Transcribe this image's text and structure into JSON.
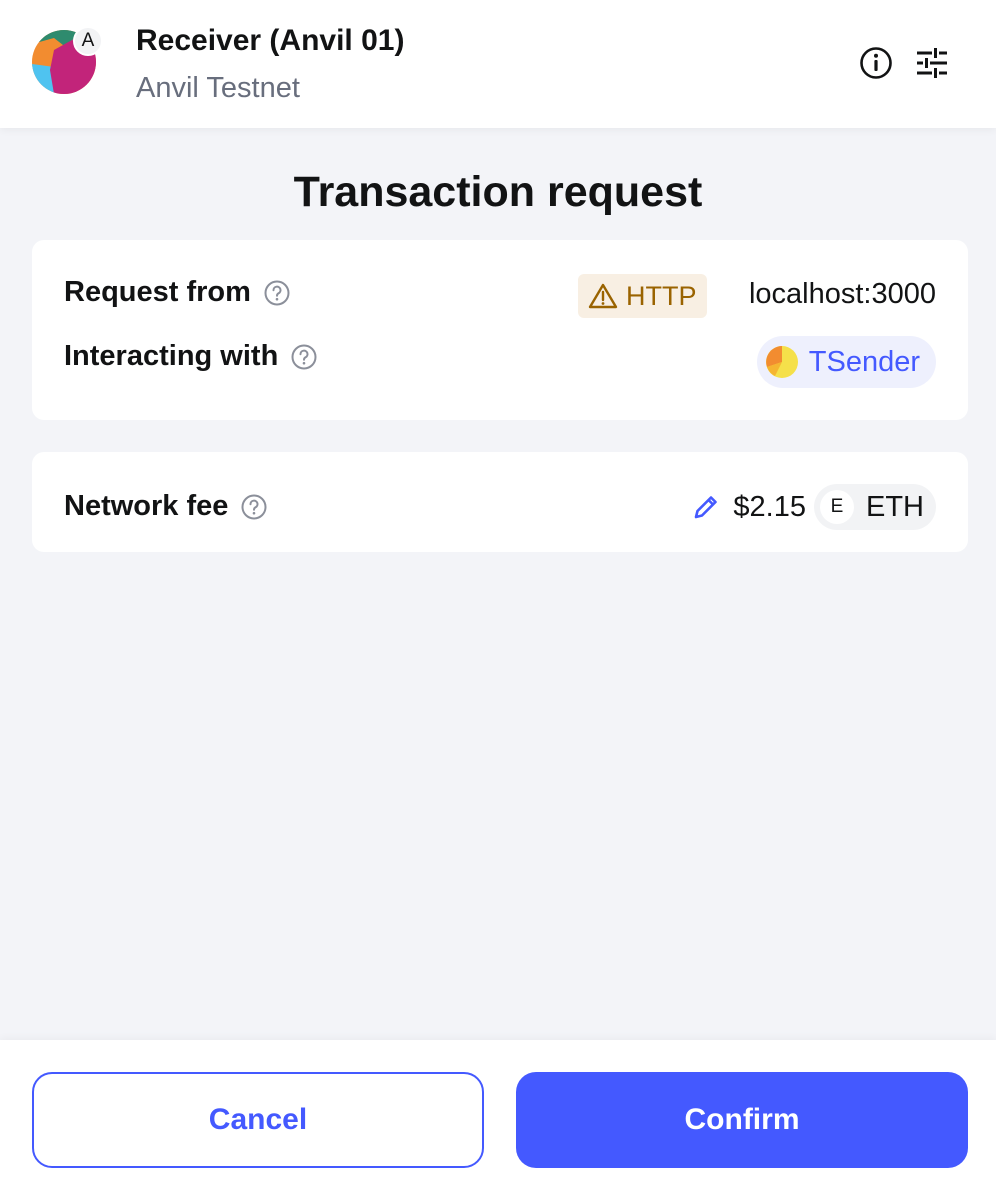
{
  "colors": {
    "accent": "#4459ff",
    "warning": "#9a6300",
    "warning_bg": "#f8efe3",
    "muted_text": "#686e7d",
    "background": "#f3f4f8"
  },
  "header": {
    "avatar_badge": "A",
    "account_name": "Receiver (Anvil 01)",
    "network_name": "Anvil Testnet",
    "icons": [
      "info-icon",
      "settings-sliders-icon"
    ]
  },
  "title": "Transaction request",
  "request": {
    "request_from_label": "Request from",
    "protocol_badge": "HTTP",
    "origin": "localhost:3000",
    "interacting_with_label": "Interacting with",
    "contract_name": "TSender"
  },
  "fee": {
    "label": "Network fee",
    "amount": "$2.15",
    "token_initial": "E",
    "token_symbol": "ETH"
  },
  "footer": {
    "cancel_label": "Cancel",
    "confirm_label": "Confirm"
  }
}
